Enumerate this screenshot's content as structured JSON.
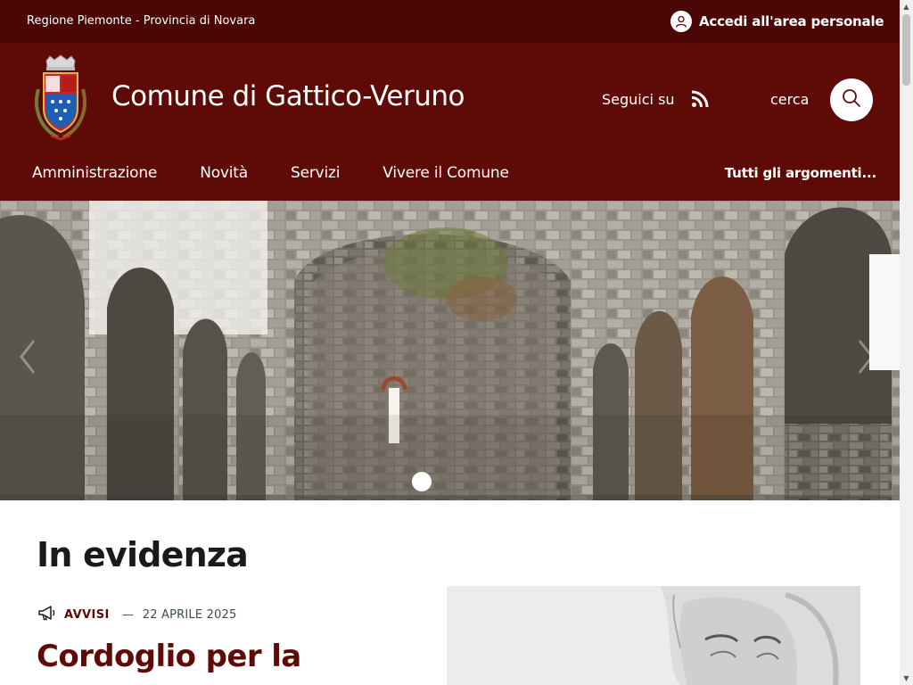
{
  "topbar": {
    "region": "Regione Piemonte - Provincia di Novara",
    "login_label": "Accedi all'area personale"
  },
  "header": {
    "site_name": "Comune di Gattico-Veruno",
    "social_label": "Seguici su",
    "social_icon": "rss-icon",
    "search_label": "cerca",
    "search_icon": "search-icon"
  },
  "nav": {
    "items": [
      {
        "label": "Amministrazione"
      },
      {
        "label": "Novità"
      },
      {
        "label": "Servizi"
      },
      {
        "label": "Vivere il Comune"
      }
    ],
    "topics_label": "Tutti gli argomenti..."
  },
  "hero": {
    "slides_count": 1,
    "active_slide": 1
  },
  "highlight": {
    "title": "In evidenza",
    "category": "AVVISI",
    "category_icon": "megaphone-icon",
    "date": "22 APRILE 2025",
    "headline": "Cordoglio per la"
  },
  "colors": {
    "topbar_bg": "#4a0705",
    "header_bg": "#5e0b08",
    "accent": "#5e0b08",
    "text": "#1a1a1a"
  }
}
